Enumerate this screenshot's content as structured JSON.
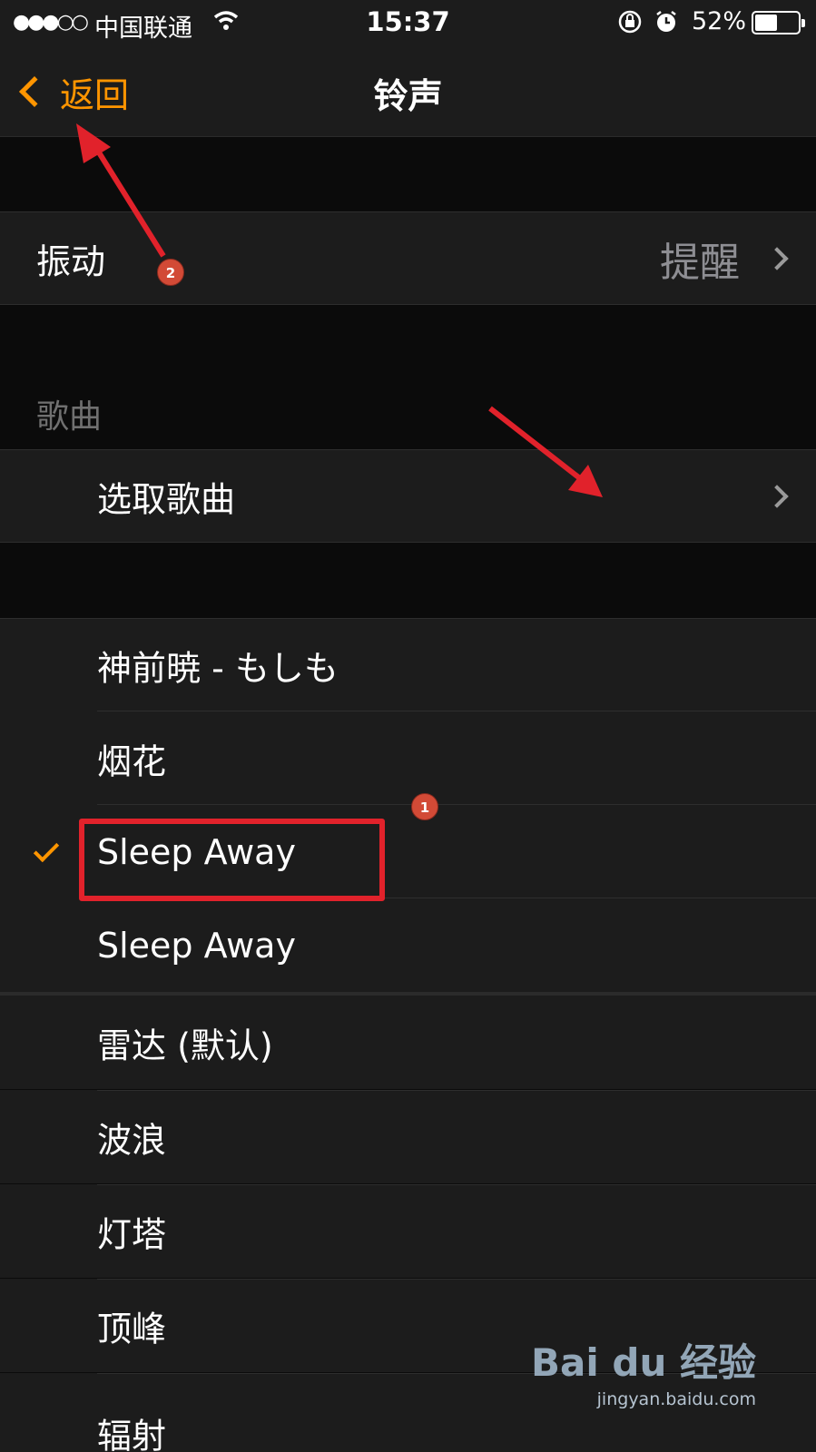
{
  "status_bar": {
    "signal": "●●●○○",
    "carrier": "中国联通",
    "time": "15:37",
    "battery_percent": "52%",
    "battery_level": 0.52
  },
  "nav": {
    "back_label": "返回",
    "title": "铃声"
  },
  "vibration_row": {
    "label": "振动",
    "value": "提醒"
  },
  "songs_section": {
    "header": "歌曲",
    "pick_song_label": "选取歌曲"
  },
  "songs": [
    {
      "label": "神前暁 - もしも",
      "checked": false
    },
    {
      "label": "烟花",
      "checked": false
    },
    {
      "label": "Sleep Away",
      "checked": true
    },
    {
      "label": "Sleep Away",
      "checked": false
    }
  ],
  "ringtones": [
    {
      "label": "雷达 (默认)"
    },
    {
      "label": "波浪"
    },
    {
      "label": "灯塔"
    },
    {
      "label": "顶峰"
    },
    {
      "label": "辐射"
    }
  ],
  "annotations": {
    "badge_1": "1",
    "badge_2": "2"
  },
  "watermark": {
    "brand": "Bai du 经验",
    "url": "jingyan.baidu.com"
  },
  "colors": {
    "accent": "#ff9500",
    "annotation_red": "#e1222b"
  }
}
